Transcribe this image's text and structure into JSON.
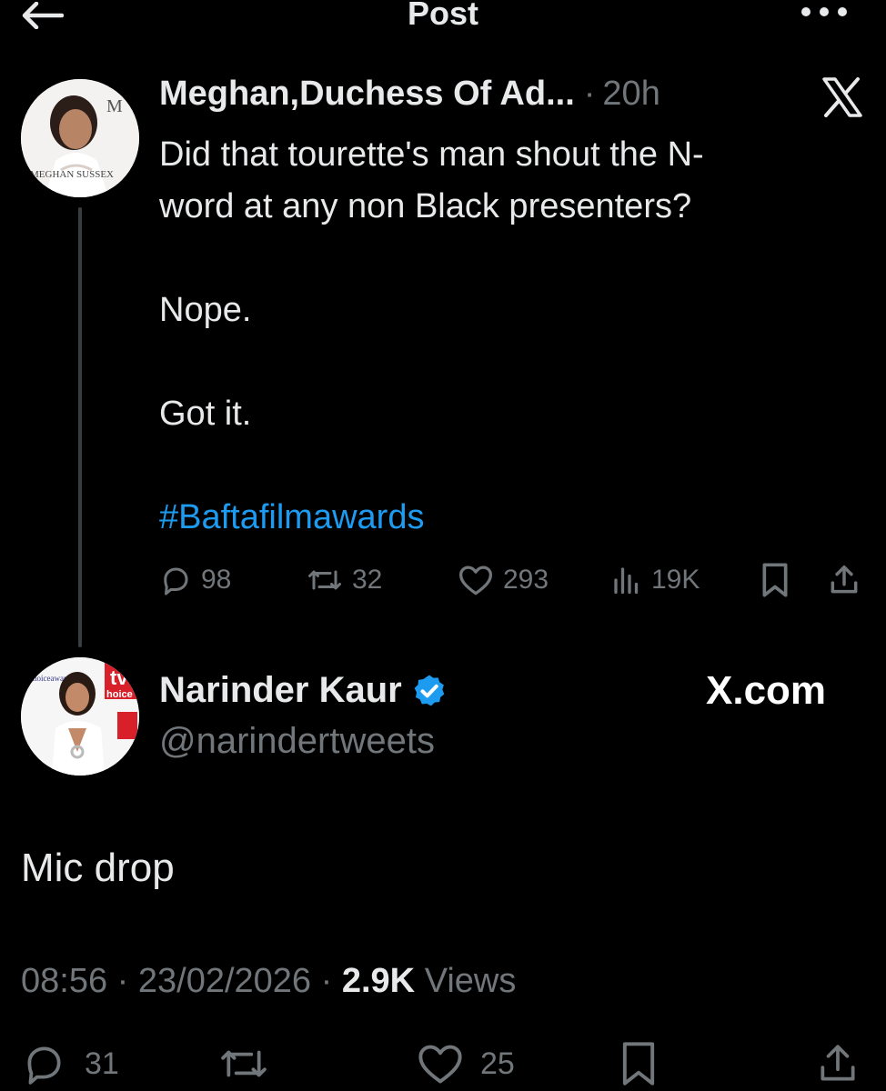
{
  "header": {
    "title": "Post",
    "back_icon": "arrow-left-icon",
    "more_icon": "more-horizontal-icon"
  },
  "quoted_tweet": {
    "author_name": "Meghan,Duchess Of Ad...",
    "separator": "·",
    "time": "20h",
    "avatar_text_top": "M",
    "avatar_text_bottom": "MEGHAN SUSSEX",
    "line1": "Did that tourette's man shout the N-",
    "line2": "word at any non Black presenters?",
    "line3": "Nope.",
    "line4": "Got it.",
    "hashtag": "#Baftafilmawards",
    "stats": {
      "replies": "98",
      "reposts": "32",
      "likes": "293",
      "views": "19K"
    }
  },
  "main_tweet": {
    "author_name": "Narinder Kaur",
    "handle": "@narindertweets",
    "watermark": "X.com",
    "text": "Mic drop",
    "time": "08:56",
    "date": "23/02/2026",
    "sep": "·",
    "views_count": "2.9K",
    "views_label": "Views",
    "avatar_badge_top": "tv",
    "avatar_badge_bottom": "hoice",
    "avatar_side_text": "tvchoiceawards",
    "stats": {
      "replies": "31",
      "likes": "25"
    }
  },
  "colors": {
    "background": "#000000",
    "text": "#e7e9ea",
    "secondary": "#71767b",
    "link": "#1d9bf0",
    "verified": "#1d9bf0"
  }
}
